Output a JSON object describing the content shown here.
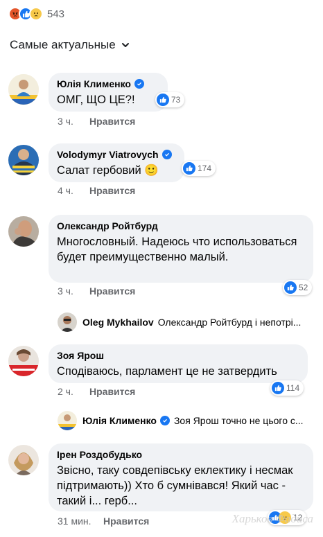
{
  "reactions": {
    "count": "543",
    "icons": [
      "angry-icon",
      "like-icon",
      "sad-icon"
    ]
  },
  "sort": {
    "label": "Самые актуальные",
    "icon": "chevron-down-icon"
  },
  "colors": {
    "like_blue": "#1877f2",
    "meta_gray": "#65676b",
    "bubble_bg": "#f0f2f5"
  },
  "comments": [
    {
      "author": "Юлія Клименко",
      "verified": true,
      "text": "ОМГ, ЩО ЦЕ?!",
      "time": "3 ч.",
      "like": "Нравится",
      "reactions_count": "73"
    },
    {
      "author": "Volodymyr Viatrovych",
      "verified": true,
      "text": "Салат гербовий 🙂",
      "time": "4 ч.",
      "like": "Нравится",
      "reactions_count": "174"
    },
    {
      "author": "Олександр Ройтбурд",
      "verified": false,
      "text": "Многословный. Надеюсь что использоваться будет преимущественно малый.",
      "time": "3 ч.",
      "like": "Нравится",
      "reactions_count": "52",
      "reply": {
        "author": "Oleg Mykhailov",
        "text": "Олександр Ройтбурд і непотрі..."
      }
    },
    {
      "author": "Зоя Ярош",
      "verified": false,
      "text": "Сподіваюсь, парламент це не затвердить",
      "time": "2 ч.",
      "like": "Нравится",
      "reactions_count": "114",
      "reply": {
        "author": "Юлія Клименко",
        "verified": true,
        "text": "Зоя Ярош точно не цього с..."
      }
    },
    {
      "author": "Ірен Роздобудько",
      "verified": false,
      "text": "Звісно, таку совдепівську еклектику і несмак підтримають)) Хто б сумнівався! Який час - такий і... герб...",
      "time": "31 мин.",
      "like": "Нравится",
      "reactions_count": "12"
    }
  ],
  "watermark": "Харьков Фадиса"
}
